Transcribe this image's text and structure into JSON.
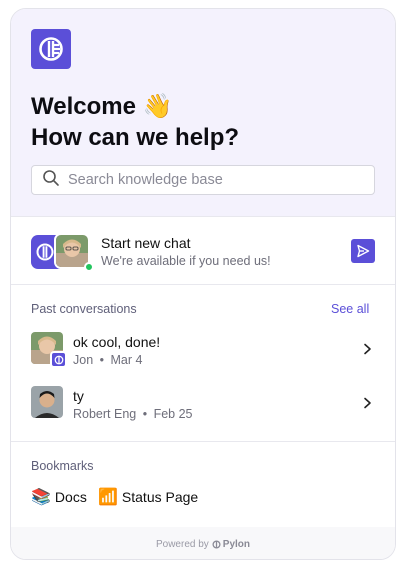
{
  "header": {
    "welcome_line": "Welcome 👋",
    "help_line": "How can we help?",
    "search_placeholder": "Search knowledge base"
  },
  "new_chat": {
    "title": "Start new chat",
    "subtitle": "We're available if you need us!"
  },
  "past_conversations": {
    "label": "Past conversations",
    "see_all": "See all",
    "items": [
      {
        "message": "ok cool, done!",
        "author": "Jon",
        "date": "Mar 4"
      },
      {
        "message": "ty",
        "author": "Robert Eng",
        "date": "Feb 25"
      }
    ]
  },
  "bookmarks": {
    "label": "Bookmarks",
    "items": [
      {
        "emoji": "📚",
        "label": "Docs"
      },
      {
        "emoji": "📶",
        "label": "Status Page"
      }
    ]
  },
  "footer": {
    "powered_by": "Powered by",
    "brand": "Pylon"
  },
  "meta_separator": "•",
  "colors": {
    "accent": "#5b4fd8",
    "header_bg": "#f4f2fd",
    "online": "#22c55e"
  },
  "icons": [
    "pylon-logo-icon",
    "search-icon",
    "send-icon",
    "chevron-right-icon"
  ]
}
